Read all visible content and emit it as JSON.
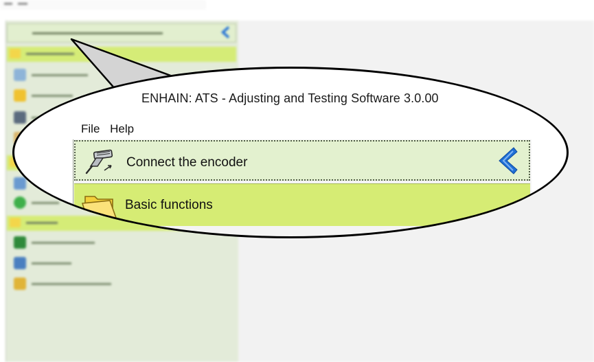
{
  "window": {
    "title": "ENHAIN: ATS - Adjusting and Testing Software 3.0.00"
  },
  "menu": {
    "file_label": "File",
    "help_label": "Help"
  },
  "sidebar": {
    "connect_label": "Connect the encoder",
    "connect_icon": "plug-connector-icon",
    "collapse_icon": "chevron-left-icon",
    "groups": [
      {
        "label": "Basic functions",
        "icon": "folder-icon"
      }
    ]
  },
  "colors": {
    "sidebar_bg": "#e3ebd9",
    "connect_bg": "#e3f1cf",
    "group_bg": "#d6ec74",
    "chevron": "#1f6fd6",
    "main_bg": "#f2f2f2",
    "outline": "#000000"
  }
}
